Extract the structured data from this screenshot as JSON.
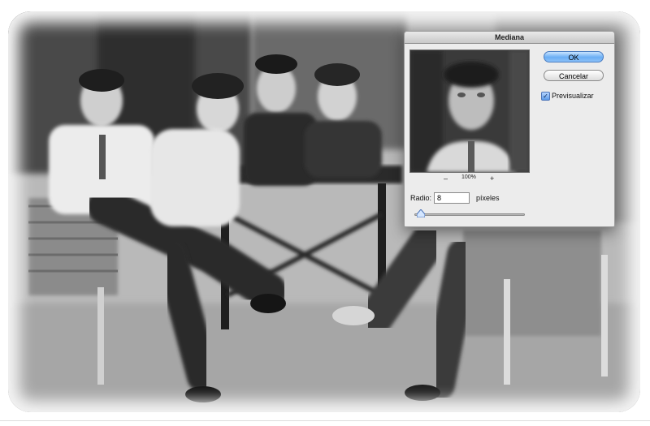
{
  "dialog": {
    "title": "Mediana",
    "ok_label": "OK",
    "cancel_label": "Cancelar",
    "preview_label": "Previsualizar",
    "preview_checked": true,
    "zoom_out_symbol": "–",
    "zoom_in_symbol": "+",
    "zoom_level": "100%",
    "radius_label": "Radio:",
    "radius_value": "8",
    "radius_unit": "píxeles",
    "slider_value_fraction": 0.06
  },
  "icons": {
    "check": "checkmark-icon",
    "zoom_out": "minus-icon",
    "zoom_in": "plus-icon",
    "slider_thumb": "slider-triangle-icon"
  },
  "colors": {
    "ok_button": "#6aaef4",
    "dialog_bg": "#ececec",
    "photo_tone": "#8a8a8a"
  }
}
